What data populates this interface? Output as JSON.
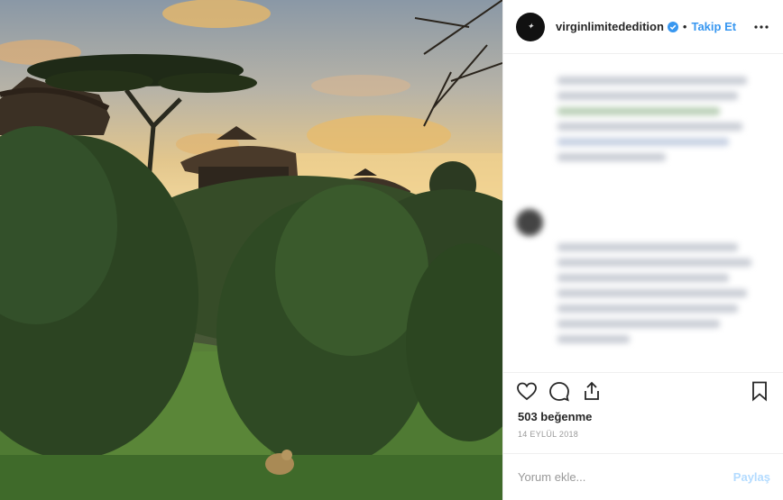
{
  "post": {
    "username": "virginlimitededition",
    "separator": "•",
    "follow_label": "Takip Et",
    "likes_text": "503 beğenme",
    "date_text": "14 EYLÜL 2018",
    "comment_placeholder": "Yorum ekle...",
    "post_label": "Paylaş"
  },
  "icons": {
    "avatar": "brand-logo-icon",
    "verified": "verified-badge-icon",
    "more": "more-options-icon",
    "like": "heart-icon",
    "comment": "comment-icon",
    "share": "share-icon",
    "save": "bookmark-icon"
  },
  "colors": {
    "link_blue": "#3897f0",
    "post_disabled": "#b3dbff",
    "text": "#262626",
    "muted": "#999999"
  }
}
